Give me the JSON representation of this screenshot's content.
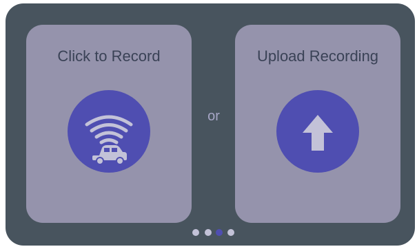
{
  "record_card": {
    "title": "Click to Record",
    "icon": "wifi-car-icon"
  },
  "separator": {
    "text": "or"
  },
  "upload_card": {
    "title": "Upload Recording",
    "icon": "upload-arrow-icon"
  },
  "pagination": {
    "count": 4,
    "active_index": 2
  },
  "colors": {
    "panel": "#48545e",
    "card": "#9593ac",
    "accent": "#4f4eb1",
    "icon": "#c3c2d8",
    "title_text": "#3a4256",
    "or_text": "#a7a6c6"
  }
}
